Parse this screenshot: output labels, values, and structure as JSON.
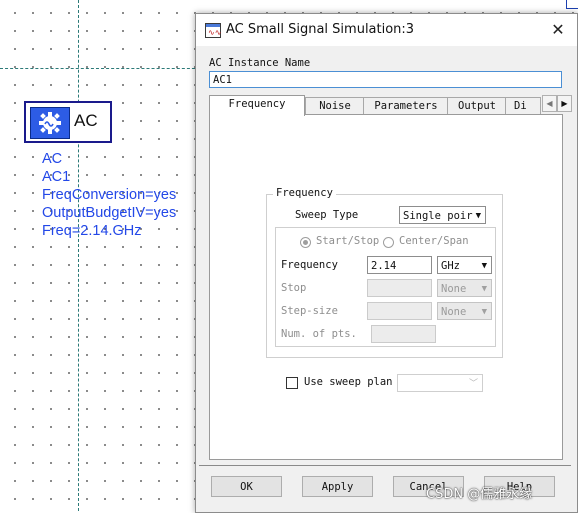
{
  "canvas": {
    "component": {
      "box_label": "AC",
      "lines": [
        "AC",
        "AC1",
        "FreqConversion=yes",
        "OutputBudgetIV=yes",
        "Freq=2.14.GHz"
      ]
    }
  },
  "dialog": {
    "title": "AC Small Signal Simulation:3",
    "close_glyph": "✕",
    "instance_label": "AC Instance Name",
    "instance_value": "AC1",
    "tabs": [
      "Frequency",
      "Noise",
      "Parameters",
      "Output",
      "Di"
    ],
    "tab_arrows": [
      "◀",
      "▶"
    ],
    "frequency_group": {
      "legend": "Frequency",
      "sweep_type_label": "Sweep Type",
      "sweep_type_value": "Single poir",
      "start_stop_label": "Start/Stop",
      "center_span_label": "Center/Span",
      "frequency_label": "Frequency",
      "frequency_value": "2.14",
      "frequency_unit": "GHz",
      "stop_label": "Stop",
      "stop_unit": "None",
      "step_label": "Step-size",
      "step_unit": "None",
      "num_pts_label": "Num. of pts."
    },
    "use_sweep_plan_label": "Use sweep plan",
    "buttons": {
      "ok": "OK",
      "apply": "Apply",
      "cancel": "Cancel",
      "help": "Help"
    }
  },
  "watermark": "CSDN @儒雅永缘"
}
